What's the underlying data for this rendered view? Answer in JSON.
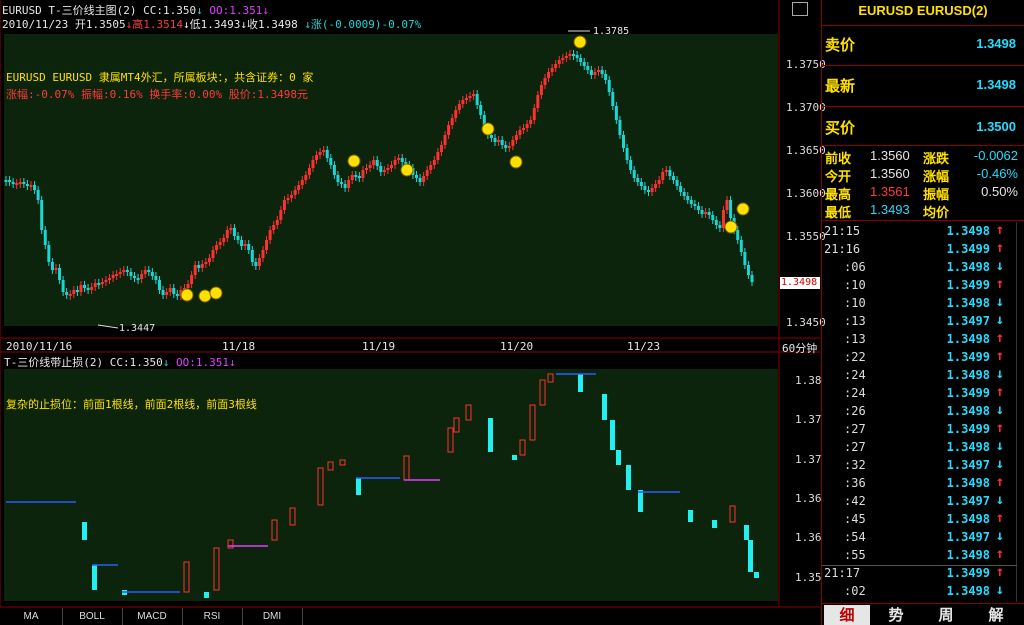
{
  "window": {
    "title": "EURUSD T-三价线主图(2) CC:1.350",
    "cc_label": "EURUSD T-三价线主图(2) CC:1.350",
    "arrow1": "↓",
    "oo_label": "OO:1.351",
    "arrow2": "↓",
    "minimize_label": "□"
  },
  "info_line": {
    "date": "2010/11/23",
    "open": "开1.3505",
    "high": "↓高1.3514",
    "low": "↓低1.3493",
    "close": "↓收1.3498",
    "change": "↓涨(-0.0009)-0.07%"
  },
  "annotations": {
    "line1": "EURUSD EURUSD 隶属MT4外汇，所属板块：，共含证券：0 家",
    "line2": "涨幅:-0.07% 振幅:0.16% 换手率:0.00% 股价:1.3498元",
    "high_marker": "1.3785",
    "low_marker": "1.3447",
    "price_tag": "1.3498",
    "sub_text": "复杂的止损位：前面1根线，前面2根线，前面3根线"
  },
  "main_axis": {
    "labels": [
      "1.3750",
      "1.3700",
      "1.3650",
      "1.3600",
      "1.3550",
      "1.3500",
      "1.3450"
    ]
  },
  "date_axis": {
    "labels": [
      "2010/11/16",
      "11/18",
      "11/19",
      "11/20",
      "11/23"
    ],
    "period": "60分钟"
  },
  "sub_header": {
    "title": "T-三价线带止损(2) CC:1.350",
    "arrow1": "↓",
    "oo": "OO:1.351",
    "arrow2": "↓"
  },
  "sub_axis": {
    "labels": [
      "1.38",
      "1.37",
      "1.37",
      "1.36",
      "1.36",
      "1.35"
    ]
  },
  "bottom_tabs": [
    "MA",
    "BOLL",
    "MACD",
    "RSI",
    "DMI"
  ],
  "right_panel": {
    "title": "EURUSD EURUSD(2)",
    "sell_label": "卖价",
    "sell_value": "1.3498",
    "last_label": "最新",
    "last_value": "1.3498",
    "buy_label": "买价",
    "buy_value": "1.3500",
    "prev_close_label": "前收",
    "prev_close_value": "1.3560",
    "change_label": "涨跌",
    "change_value": "-0.0062",
    "open_label": "今开",
    "open_value": "1.3560",
    "pct_label": "涨幅",
    "pct_value": "-0.46%",
    "high_label": "最高",
    "high_value": "1.3561",
    "amp_label": "振幅",
    "amp_value": "0.50%",
    "low_label": "最低",
    "low_value": "1.3493",
    "avg_label": "均价",
    "avg_value": ""
  },
  "ticks": [
    {
      "time": "21:15",
      "price": "1.3498",
      "dir": "up"
    },
    {
      "time": "21:16",
      "price": "1.3499",
      "dir": "up"
    },
    {
      "time": ":06",
      "price": "1.3498",
      "dir": "down"
    },
    {
      "time": ":10",
      "price": "1.3499",
      "dir": "up"
    },
    {
      "time": ":10",
      "price": "1.3498",
      "dir": "down"
    },
    {
      "time": ":13",
      "price": "1.3497",
      "dir": "down"
    },
    {
      "time": ":13",
      "price": "1.3498",
      "dir": "up"
    },
    {
      "time": ":22",
      "price": "1.3499",
      "dir": "up"
    },
    {
      "time": ":24",
      "price": "1.3498",
      "dir": "down"
    },
    {
      "time": ":24",
      "price": "1.3499",
      "dir": "up"
    },
    {
      "time": ":26",
      "price": "1.3498",
      "dir": "down"
    },
    {
      "time": ":27",
      "price": "1.3499",
      "dir": "up"
    },
    {
      "time": ":27",
      "price": "1.3498",
      "dir": "down"
    },
    {
      "time": ":32",
      "price": "1.3497",
      "dir": "down"
    },
    {
      "time": ":36",
      "price": "1.3498",
      "dir": "up"
    },
    {
      "time": ":42",
      "price": "1.3497",
      "dir": "down"
    },
    {
      "time": ":45",
      "price": "1.3498",
      "dir": "up"
    },
    {
      "time": ":54",
      "price": "1.3497",
      "dir": "down"
    },
    {
      "time": ":55",
      "price": "1.3498",
      "dir": "up"
    },
    {
      "time": "21:17",
      "price": "1.3499",
      "dir": "up"
    },
    {
      "time": ":02",
      "price": "1.3498",
      "dir": "down"
    }
  ],
  "right_tabs": [
    "细",
    "势",
    "周",
    "解"
  ],
  "colors": {
    "up": "#ff3030",
    "down": "#1ad6d6",
    "chart_bg": "#0a220a",
    "grid_border": "#8a0000"
  }
}
